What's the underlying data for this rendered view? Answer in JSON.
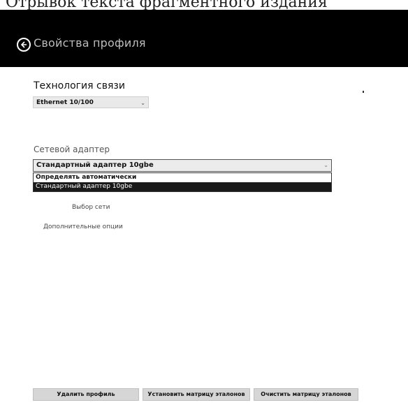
{
  "page_top_text": "Отрывок текста фрагментного издания",
  "header": {
    "title": "Свойства профиля"
  },
  "connection": {
    "label": "Технология связи",
    "value": "Ethernet 10/100"
  },
  "adapter": {
    "label": "Сетевой адаптер",
    "value": "Стандартный адаптер 10gbe",
    "options": [
      "Определять автоматически",
      "Стандартный адаптер 10gbe"
    ],
    "selected_index": 1
  },
  "links": {
    "network": "Выбор сети",
    "options": "Дополнительные опции"
  },
  "buttons": {
    "delete": "Удалить профиль",
    "set_matrix": "Установить матрицу эталонов",
    "clear_matrix": "Очистить матрицу эталонов"
  },
  "colors": {
    "header_bg": "#000000",
    "selected_bg": "#1a1a1a"
  }
}
